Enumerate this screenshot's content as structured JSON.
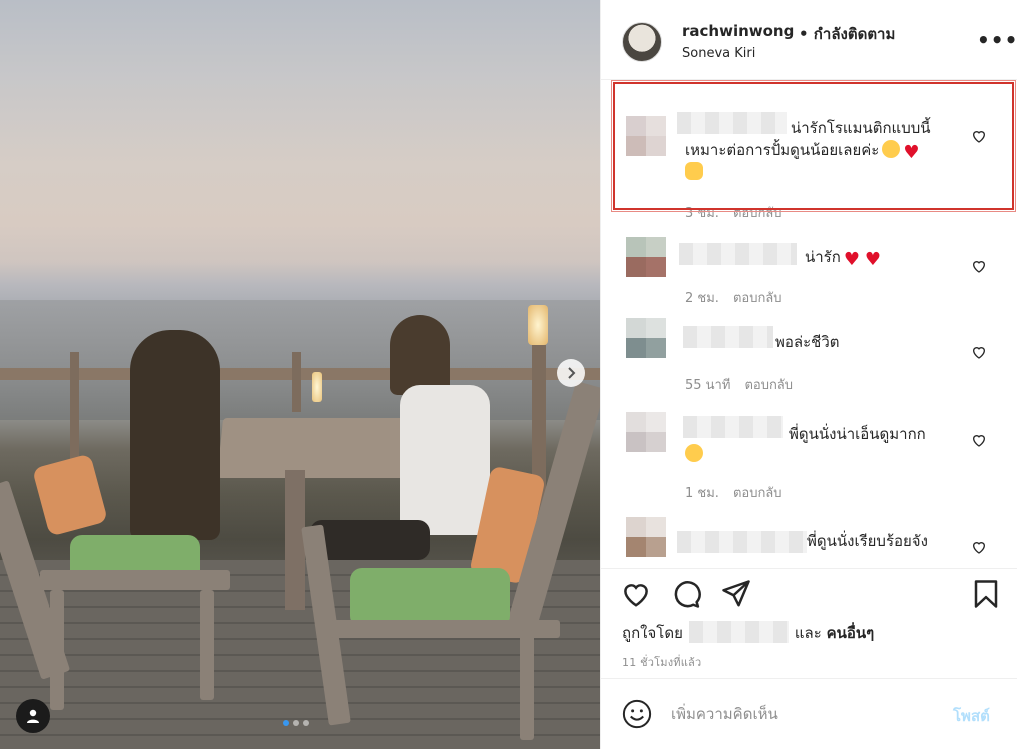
{
  "post": {
    "username": "rachwinwong",
    "follow_status": "• กำลังติดตาม",
    "location": "Soneva Kiri",
    "more_icon": "more-icon"
  },
  "carousel": {
    "dots": 3,
    "active_dot": 1
  },
  "comments": [
    {
      "text_line1": "น่ารักโรแมนติกแบบนี้",
      "text_line2": "เหมาะต่อการปั้มดูนน้อยเลยค่ะ",
      "time": "3 ชม.",
      "reply": "ตอบกลับ",
      "highlighted": true
    },
    {
      "text_line1": "น่ารัก",
      "time": "2 ชม.",
      "reply": "ตอบกลับ"
    },
    {
      "text_line1": "พอล่ะชีวิต",
      "time": "55 นาที",
      "reply": "ตอบกลับ"
    },
    {
      "text_line1": "พี่ดูนนั่งน่าเอ็นดูมากก",
      "time": "1 ชม.",
      "reply": "ตอบกลับ"
    },
    {
      "text_line1": "พี่ดูนนั่งเรียบร้อยจัง"
    }
  ],
  "actions": {
    "liked_by_prefix": "ถูกใจโดย",
    "liked_by_suffix": "และ",
    "others": "คนอื่นๆ",
    "timestamp": "11 ชั่วโมงที่แล้ว"
  },
  "add_comment": {
    "placeholder": "เพิ่มความคิดเห็น",
    "post_label": "โพสต์"
  },
  "colors": {
    "text": "#262626",
    "muted": "#8e8e8e",
    "post_disabled": "#b2dffc",
    "highlight_border": "#d0342c",
    "active_dot": "#3897f0"
  }
}
